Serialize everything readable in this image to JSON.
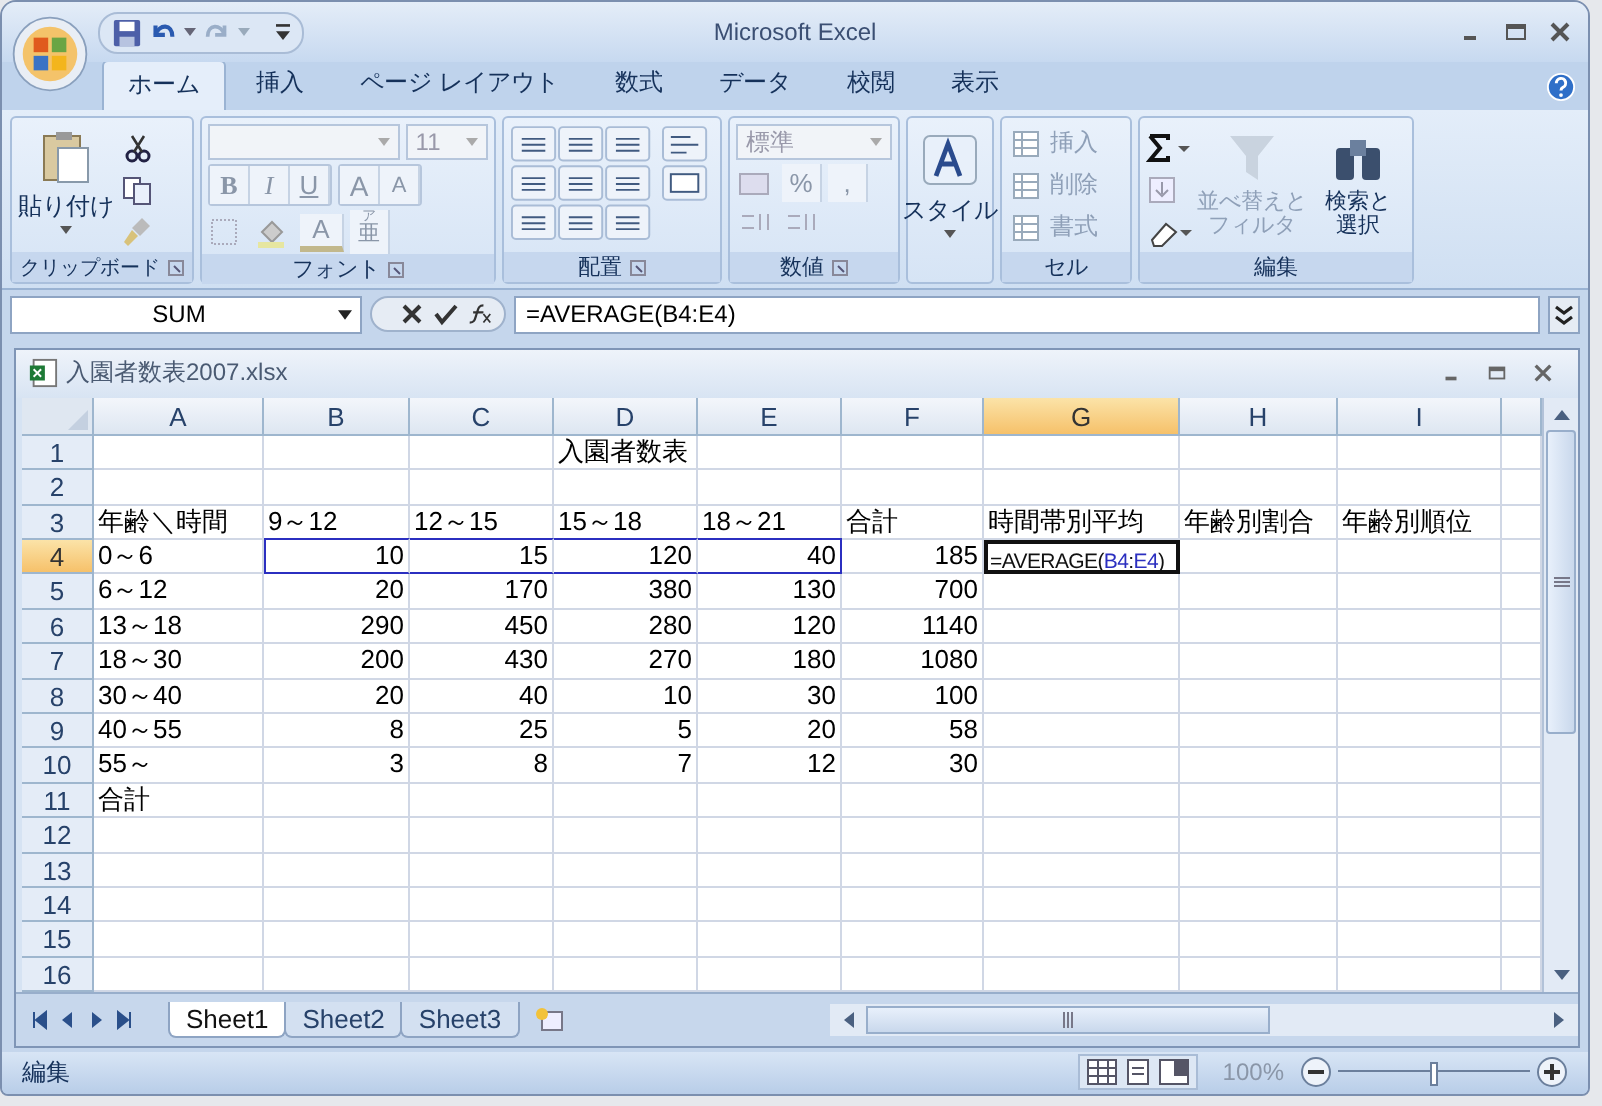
{
  "window": {
    "title": "Microsoft Excel"
  },
  "tabs": [
    {
      "label": "ホーム",
      "selected": true
    },
    {
      "label": "挿入",
      "selected": false
    },
    {
      "label": "ページ レイアウト",
      "selected": false
    },
    {
      "label": "数式",
      "selected": false
    },
    {
      "label": "データ",
      "selected": false
    },
    {
      "label": "校閲",
      "selected": false
    },
    {
      "label": "表示",
      "selected": false
    }
  ],
  "ribbon": {
    "clipboard": {
      "label": "クリップボード",
      "paste": "貼り付け"
    },
    "font": {
      "label": "フォント",
      "size": "11",
      "bold": "B",
      "italic": "I",
      "underline": "U",
      "grow": "A",
      "shrink": "A",
      "font_color": "A",
      "phonetic_ruby": "ア",
      "phonetic_base": "亜"
    },
    "alignment": {
      "label": "配置"
    },
    "number": {
      "label": "数値",
      "format": "標準",
      "percent": "%",
      "comma": ","
    },
    "styles": {
      "label": "スタイル"
    },
    "cells": {
      "label": "セル",
      "items": [
        {
          "label": "挿入",
          "disabled": true
        },
        {
          "label": "削除",
          "disabled": true
        },
        {
          "label": "書式",
          "disabled": true
        }
      ]
    },
    "editing": {
      "label": "編集",
      "sort": {
        "label": [
          "並べ替えと",
          "フィルタ"
        ],
        "disabled": true
      },
      "find": {
        "label": [
          "検索と",
          "選択"
        ],
        "disabled": false
      }
    }
  },
  "formula_bar": {
    "name_box": "SUM",
    "formula": "=AVERAGE(B4:E4)"
  },
  "workbook": {
    "title": "入園者数表2007.xlsx",
    "columns": [
      {
        "label": "A",
        "selected": false
      },
      {
        "label": "B",
        "selected": false
      },
      {
        "label": "C",
        "selected": false
      },
      {
        "label": "D",
        "selected": false
      },
      {
        "label": "E",
        "selected": false
      },
      {
        "label": "F",
        "selected": false
      },
      {
        "label": "G",
        "selected": true
      },
      {
        "label": "H",
        "selected": false
      },
      {
        "label": "I",
        "selected": false
      }
    ],
    "rows": [
      {
        "number": "1",
        "selected": false,
        "cells": [
          null,
          null,
          null,
          {
            "text": "入園者数表",
            "kind": "text"
          }
        ]
      },
      {
        "number": "2",
        "selected": false,
        "cells": []
      },
      {
        "number": "3",
        "selected": false,
        "cells": [
          {
            "text": "年齢＼時間",
            "kind": "text"
          },
          {
            "text": "9～12",
            "kind": "text"
          },
          {
            "text": "12～15",
            "kind": "text"
          },
          {
            "text": "15～18",
            "kind": "text"
          },
          {
            "text": "18～21",
            "kind": "text"
          },
          {
            "text": "合計",
            "kind": "text"
          },
          {
            "text": "時間帯別平均",
            "kind": "text"
          },
          {
            "text": "年齢別割合",
            "kind": "text"
          },
          {
            "text": "年齢別順位",
            "kind": "text"
          }
        ]
      },
      {
        "number": "4",
        "selected": true,
        "cells": [
          {
            "text": "0～6",
            "kind": "text"
          },
          {
            "text": "10",
            "kind": "number",
            "referenced": true
          },
          {
            "text": "15",
            "kind": "number",
            "referenced": true
          },
          {
            "text": "120",
            "kind": "number",
            "referenced": true
          },
          {
            "text": "40",
            "kind": "number",
            "referenced": true
          },
          {
            "text": "185",
            "kind": "number"
          },
          {
            "kind": "formula",
            "active": true,
            "parts": [
              {
                "text": "=AVERAGE(",
                "ref": false
              },
              {
                "text": "B4",
                "ref": true
              },
              {
                "text": ":",
                "ref": false
              },
              {
                "text": "E4",
                "ref": true
              },
              {
                "text": ")",
                "ref": false
              }
            ]
          }
        ]
      },
      {
        "number": "5",
        "selected": false,
        "cells": [
          {
            "text": "6～12",
            "kind": "text"
          },
          {
            "text": "20",
            "kind": "number"
          },
          {
            "text": "170",
            "kind": "number"
          },
          {
            "text": "380",
            "kind": "number"
          },
          {
            "text": "130",
            "kind": "number"
          },
          {
            "text": "700",
            "kind": "number"
          }
        ]
      },
      {
        "number": "6",
        "selected": false,
        "cells": [
          {
            "text": "13～18",
            "kind": "text"
          },
          {
            "text": "290",
            "kind": "number"
          },
          {
            "text": "450",
            "kind": "number"
          },
          {
            "text": "280",
            "kind": "number"
          },
          {
            "text": "120",
            "kind": "number"
          },
          {
            "text": "1140",
            "kind": "number"
          }
        ]
      },
      {
        "number": "7",
        "selected": false,
        "cells": [
          {
            "text": "18～30",
            "kind": "text"
          },
          {
            "text": "200",
            "kind": "number"
          },
          {
            "text": "430",
            "kind": "number"
          },
          {
            "text": "270",
            "kind": "number"
          },
          {
            "text": "180",
            "kind": "number"
          },
          {
            "text": "1080",
            "kind": "number"
          }
        ]
      },
      {
        "number": "8",
        "selected": false,
        "cells": [
          {
            "text": "30～40",
            "kind": "text"
          },
          {
            "text": "20",
            "kind": "number"
          },
          {
            "text": "40",
            "kind": "number"
          },
          {
            "text": "10",
            "kind": "number"
          },
          {
            "text": "30",
            "kind": "number"
          },
          {
            "text": "100",
            "kind": "number"
          }
        ]
      },
      {
        "number": "9",
        "selected": false,
        "cells": [
          {
            "text": "40～55",
            "kind": "text"
          },
          {
            "text": "8",
            "kind": "number"
          },
          {
            "text": "25",
            "kind": "number"
          },
          {
            "text": "5",
            "kind": "number"
          },
          {
            "text": "20",
            "kind": "number"
          },
          {
            "text": "58",
            "kind": "number"
          }
        ]
      },
      {
        "number": "10",
        "selected": false,
        "cells": [
          {
            "text": "55～",
            "kind": "text"
          },
          {
            "text": "3",
            "kind": "number"
          },
          {
            "text": "8",
            "kind": "number"
          },
          {
            "text": "7",
            "kind": "number"
          },
          {
            "text": "12",
            "kind": "number"
          },
          {
            "text": "30",
            "kind": "number"
          }
        ]
      },
      {
        "number": "11",
        "selected": false,
        "cells": [
          {
            "text": "合計",
            "kind": "text"
          }
        ]
      },
      {
        "number": "12",
        "selected": false,
        "cells": []
      },
      {
        "number": "13",
        "selected": false,
        "cells": []
      },
      {
        "number": "14",
        "selected": false,
        "cells": []
      },
      {
        "number": "15",
        "selected": false,
        "cells": []
      },
      {
        "number": "16",
        "selected": false,
        "cells": []
      }
    ],
    "sheets": [
      {
        "label": "Sheet1",
        "selected": true
      },
      {
        "label": "Sheet2",
        "selected": false
      },
      {
        "label": "Sheet3",
        "selected": false
      }
    ]
  },
  "status_bar": {
    "mode": "編集",
    "zoom": "100%",
    "zoom_level": {
      "level": 0.5
    }
  }
}
